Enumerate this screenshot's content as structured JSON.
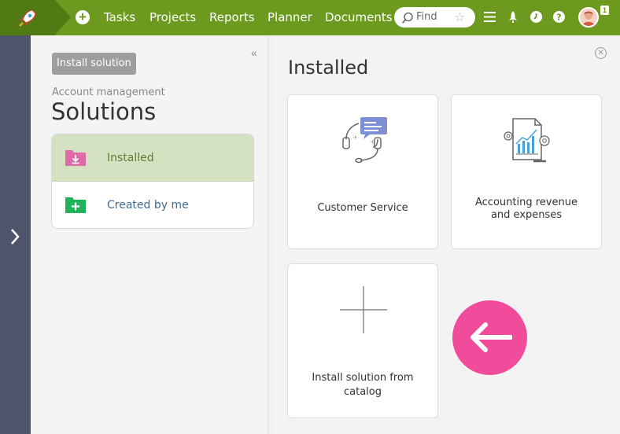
{
  "topbar": {
    "nav": [
      "Tasks",
      "Projects",
      "Reports",
      "Planner",
      "Documents"
    ],
    "search_placeholder": "Find",
    "notification_count": "1",
    "icons": [
      "rocket-logo-icon",
      "add-icon",
      "search-icon",
      "star-icon",
      "menu-icon",
      "rocket-icon",
      "timer-icon",
      "help-icon",
      "avatar"
    ],
    "accent": "#6c9a1f"
  },
  "left": {
    "tag": "Install solution",
    "subtitle": "Account management",
    "title": "Solutions",
    "items": [
      {
        "label": "Installed",
        "icon": "folder-download-icon",
        "color": "#e06aa8"
      },
      {
        "label": "Created by me",
        "icon": "folder-add-icon",
        "color": "#21b359"
      }
    ]
  },
  "main": {
    "title": "Installed",
    "cards": [
      {
        "label": "Customer Service",
        "icon": "headset-chat-icon"
      },
      {
        "label_line1": "Accounting revenue",
        "label_line2": "and expenses",
        "icon": "report-chart-icon"
      },
      {
        "label_line1": "Install solution from",
        "label_line2": "catalog",
        "icon": "plus-icon"
      }
    ],
    "pointer_color": "#f14b9c"
  }
}
